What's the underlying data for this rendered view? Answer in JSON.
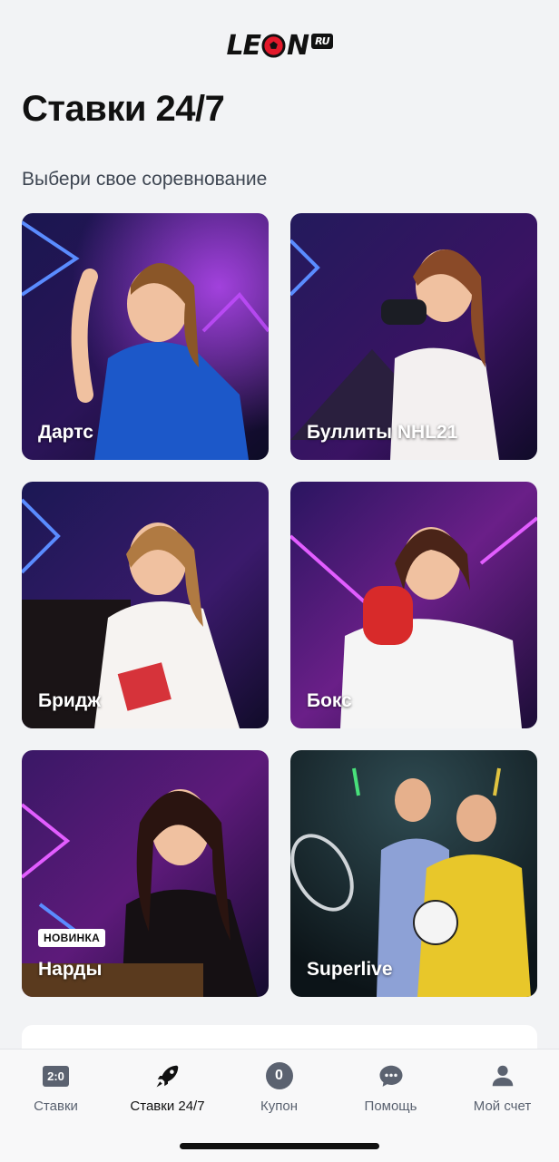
{
  "brand": {
    "logo_text_left": "LE",
    "logo_text_right": "N",
    "logo_ru": "RU"
  },
  "page": {
    "title": "Ставки 24/7",
    "subtitle": "Выбери свое соревнование"
  },
  "cards": [
    {
      "label": "Дартс",
      "badge": ""
    },
    {
      "label": "Буллиты NHL21",
      "badge": ""
    },
    {
      "label": "Бридж",
      "badge": ""
    },
    {
      "label": "Бокс",
      "badge": ""
    },
    {
      "label": "Нарды",
      "badge": "НОВИНКА"
    },
    {
      "label": "Superlive",
      "badge": ""
    }
  ],
  "tabbar": {
    "items": [
      {
        "label": "Ставки",
        "icon": "score-icon",
        "icon_text": "2:0",
        "active": false
      },
      {
        "label": "Ставки 24/7",
        "icon": "rocket-icon",
        "active": true
      },
      {
        "label": "Купон",
        "icon": "coupon-icon",
        "icon_text": "0",
        "active": false
      },
      {
        "label": "Помощь",
        "icon": "chat-icon",
        "active": false
      },
      {
        "label": "Мой счет",
        "icon": "user-icon",
        "active": false
      }
    ]
  },
  "colors": {
    "background": "#f2f3f5",
    "accent_red": "#e3192b",
    "neon_purple": "#b24cff",
    "neon_blue": "#4a7dff",
    "tab_icon": "#5b6270"
  }
}
